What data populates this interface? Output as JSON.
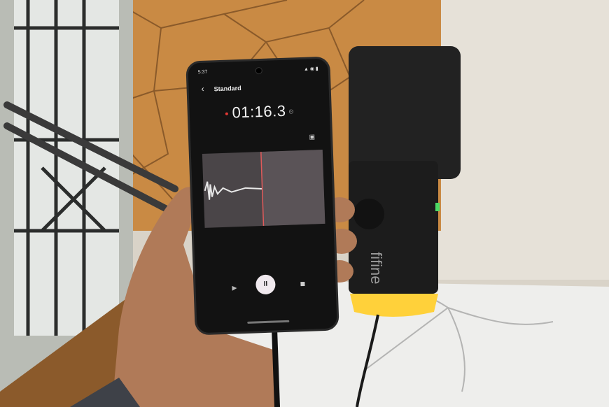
{
  "phone": {
    "status_time": "5:37",
    "header_title": "Standard",
    "timer": "01:16.3"
  },
  "colors": {
    "wall_tiles": "#c98a44",
    "mic_body": "#1c1c1c",
    "mic_glow": "#ffd13a",
    "recording_dot": "#e53935",
    "waveform_bg": "#4a4548"
  },
  "icons": {
    "back": "chevron-left-icon",
    "save": "save-icon",
    "play": "play-icon",
    "pause": "pause-icon",
    "stop": "stop-icon"
  }
}
